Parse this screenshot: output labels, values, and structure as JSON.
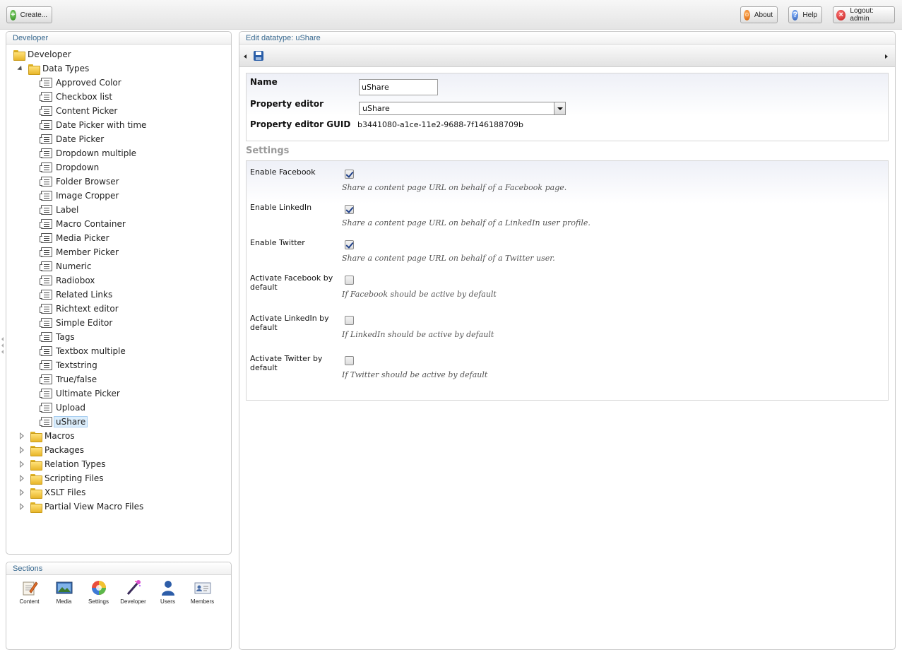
{
  "topbar": {
    "create_label": "Create...",
    "about_label": "About",
    "help_label": "Help",
    "logout_label": "Logout: admin"
  },
  "tree_panel": {
    "title": "Developer",
    "root_label": "Developer",
    "data_types_label": "Data Types",
    "data_types": [
      "Approved Color",
      "Checkbox list",
      "Content Picker",
      "Date Picker with time",
      "Date Picker",
      "Dropdown multiple",
      "Dropdown",
      "Folder Browser",
      "Image Cropper",
      "Label",
      "Macro Container",
      "Media Picker",
      "Member Picker",
      "Numeric",
      "Radiobox",
      "Related Links",
      "Richtext editor",
      "Simple Editor",
      "Tags",
      "Textbox multiple",
      "Textstring",
      "True/false",
      "Ultimate Picker",
      "Upload",
      "uShare"
    ],
    "selected_item": "uShare",
    "folders": [
      "Macros",
      "Packages",
      "Relation Types",
      "Scripting Files",
      "XSLT Files",
      "Partial View Macro Files"
    ]
  },
  "sections_panel": {
    "title": "Sections",
    "items": [
      {
        "label": "Content",
        "icon": "content-icon"
      },
      {
        "label": "Media",
        "icon": "media-icon"
      },
      {
        "label": "Settings",
        "icon": "settings-icon"
      },
      {
        "label": "Developer",
        "icon": "developer-icon"
      },
      {
        "label": "Users",
        "icon": "users-icon"
      },
      {
        "label": "Members",
        "icon": "members-icon"
      }
    ]
  },
  "editor": {
    "title": "Edit datatype: uShare",
    "name_label": "Name",
    "name_value": "uShare",
    "property_editor_label": "Property editor",
    "property_editor_value": "uShare",
    "guid_label": "Property editor GUID",
    "guid_value": "b3441080-a1ce-11e2-9688-7f146188709b",
    "settings_title": "Settings",
    "settings": [
      {
        "label": "Enable Facebook",
        "checked": true,
        "desc": "Share a content page URL on behalf of a Facebook page."
      },
      {
        "label": "Enable LinkedIn",
        "checked": true,
        "desc": "Share a content page URL on behalf of a LinkedIn user profile."
      },
      {
        "label": "Enable Twitter",
        "checked": true,
        "desc": "Share a content page URL on behalf of a Twitter user."
      },
      {
        "label_line1": "Activate Facebook by",
        "label_line2": "default",
        "checked": false,
        "desc": "If Facebook should be active by default"
      },
      {
        "label_line1": "Activate LinkedIn by",
        "label_line2": "default",
        "checked": false,
        "desc": "If LinkedIn should be active by default"
      },
      {
        "label_line1": "Activate Twitter by",
        "label_line2": "default",
        "checked": false,
        "desc": "If Twitter should be active by default"
      }
    ]
  }
}
